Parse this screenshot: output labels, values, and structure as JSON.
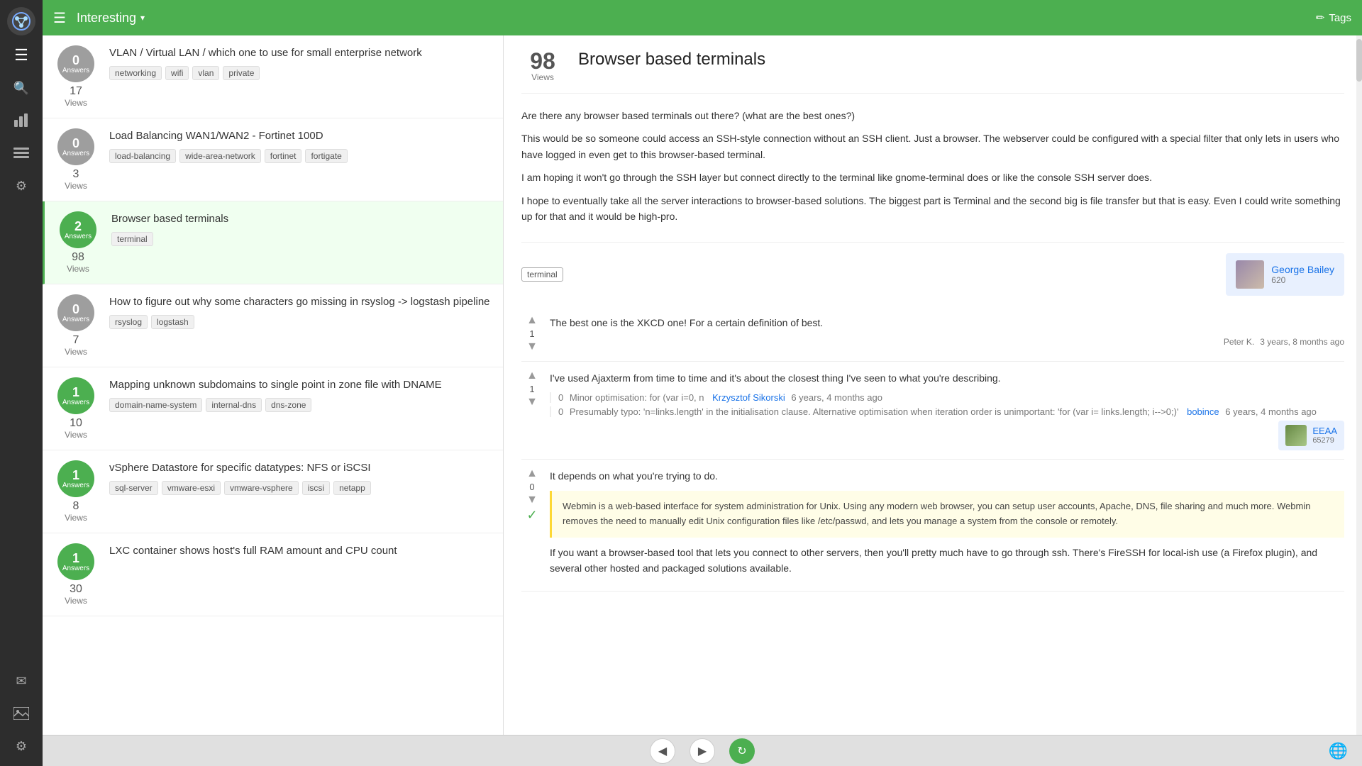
{
  "sidebar": {
    "logo_icon": "◉",
    "icons": [
      {
        "name": "menu",
        "symbol": "☰",
        "active": true
      },
      {
        "name": "search",
        "symbol": "🔍"
      },
      {
        "name": "chart",
        "symbol": "📊"
      },
      {
        "name": "list",
        "symbol": "☰"
      },
      {
        "name": "settings",
        "symbol": "⚙"
      },
      {
        "name": "mail",
        "symbol": "✉"
      },
      {
        "name": "image",
        "symbol": "🖼"
      },
      {
        "name": "settings2",
        "symbol": "⚙"
      }
    ]
  },
  "topbar": {
    "menu_label": "☰",
    "title": "Interesting",
    "dropdown_arrow": "▾",
    "tags_icon": "🏷",
    "tags_label": "Tags"
  },
  "questions": [
    {
      "id": "vlan",
      "answers": 0,
      "views": 17,
      "has_answers": false,
      "title": "VLAN / Virtual LAN / which one to use for small enterprise network",
      "tags": [
        "networking",
        "wifi",
        "vlan",
        "private"
      ]
    },
    {
      "id": "fortinet",
      "answers": 0,
      "views": 3,
      "has_answers": false,
      "title": "Load Balancing WAN1/WAN2 - Fortinet 100D",
      "tags": [
        "load-balancing",
        "wide-area-network",
        "fortinet",
        "fortigate"
      ]
    },
    {
      "id": "browser-terminals",
      "answers": 2,
      "views": 98,
      "has_answers": true,
      "title": "Browser based terminals",
      "tags": [
        "terminal"
      ],
      "active": true
    },
    {
      "id": "rsyslog",
      "answers": 0,
      "views": 7,
      "has_answers": false,
      "title": "How to figure out why some characters go missing in rsyslog -> logstash pipeline",
      "tags": [
        "rsyslog",
        "logstash"
      ]
    },
    {
      "id": "dname",
      "answers": 1,
      "views": 10,
      "has_answers": true,
      "title": "Mapping unknown subdomains to single point in zone file with DNAME",
      "tags": [
        "domain-name-system",
        "internal-dns",
        "dns-zone"
      ]
    },
    {
      "id": "vsphere",
      "answers": 1,
      "views": 8,
      "has_answers": true,
      "title": "vSphere Datastore for specific datatypes: NFS or iSCSI",
      "tags": [
        "sql-server",
        "vmware-esxi",
        "vmware-vsphere",
        "iscsi",
        "netapp"
      ]
    },
    {
      "id": "lxc",
      "answers": 1,
      "views": 30,
      "has_answers": true,
      "title": "LXC container shows host's full RAM amount and CPU count",
      "tags": []
    }
  ],
  "detail": {
    "views_count": "98",
    "views_label": "Views",
    "title": "Browser based terminals",
    "question_body": [
      "Are there any browser based terminals out there? (what are the best ones?)",
      "This would be so someone could access an SSH-style connection without an SSH client. Just a browser. The webserver could be configured with a special filter that only lets in users who have logged in even get to this browser-based terminal.",
      "I am hoping it won't go through the SSH layer but connect directly to the terminal like gnome-terminal does or like the console SSH server does.",
      "I hope to eventually take all the server interactions to browser-based solutions. The biggest part is Terminal and the second big is file transfer but that is easy. Even I could write something up for that and it would be high-pro."
    ],
    "question_tag": "terminal",
    "question_user": {
      "name": "George Bailey",
      "rep": "620"
    },
    "answers": [
      {
        "vote_count": 1,
        "accepted": false,
        "text": "The best one is the XKCD one! For a certain definition of best.",
        "user_name": "Peter K.",
        "time_ago": "3 years, 8 months ago",
        "comments": []
      },
      {
        "vote_count": 1,
        "accepted": false,
        "text": "I've used  Ajaxterm  from time to time and it's about the closest thing I've seen to what you're describing.",
        "user_name": "EEAA",
        "user_rep": "65279",
        "time_ago": "",
        "comments": [
          {
            "vote_count": 0,
            "text": "Minor optimisation: for (var i=0, n",
            "user_name": "Krzysztof Sikorski",
            "time_ago": "6 years, 4 months ago"
          },
          {
            "vote_count": 0,
            "text": "Presumably typo: 'n=links.length' in the initialisation clause. Alternative optimisation when iteration order is unimportant: 'for (var i= links.length; i-->0;)'",
            "user_name": "bobince",
            "time_ago": "6 years, 4 months ago"
          }
        ]
      },
      {
        "vote_count": 0,
        "accepted": true,
        "text": "It depends on what you're trying to do.",
        "blockquote": "Webmin is a web-based interface for system administration for Unix. Using any modern web browser, you can setup user accounts, Apache, DNS, file sharing and much more. Webmin removes the need to manually edit Unix configuration files like /etc/passwd, and lets you manage a system from the console or remotely.",
        "secondary_text": "If you want a browser-based tool that lets you connect to other servers, then you'll pretty much have to go through ssh. There's FireSSH  for local-ish use (a Firefox plugin), and several other  hosted and packaged solutions  available.",
        "user_name": "",
        "time_ago": ""
      }
    ]
  },
  "bottombar": {
    "back_icon": "◀",
    "forward_icon": "▶",
    "refresh_icon": "↻",
    "globe_icon": "🌐"
  }
}
